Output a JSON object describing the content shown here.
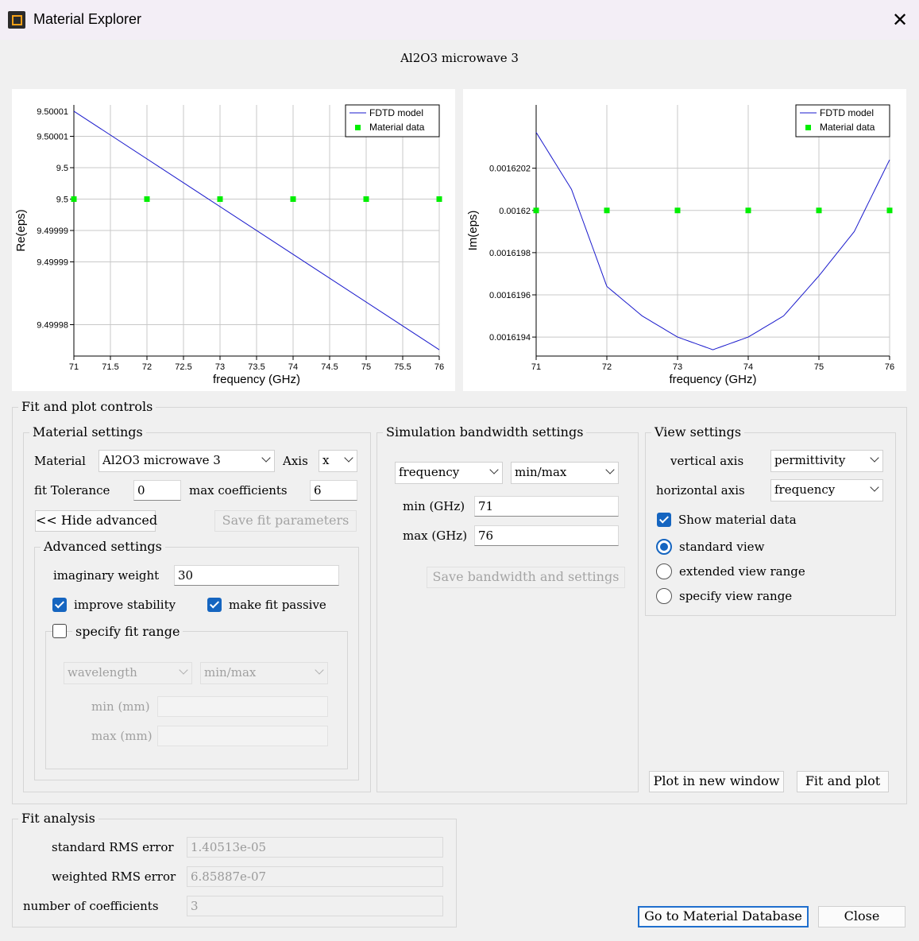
{
  "window": {
    "title": "Material Explorer",
    "close_glyph": "✕"
  },
  "plot_title": "Al2O3 microwave 3",
  "chart_data": [
    {
      "type": "line",
      "ylabel": "Re(eps)",
      "xlabel": "frequency (GHz)",
      "xlim": [
        71,
        76
      ],
      "ylim": [
        9.499975,
        9.500015
      ],
      "xticks": [
        71,
        71.5,
        72,
        72.5,
        73,
        73.5,
        74,
        74.5,
        75,
        75.5,
        76
      ],
      "xtick_labels": [
        "71",
        "71.5",
        "72",
        "72.5",
        "73",
        "73.5",
        "74",
        "74.5",
        "75",
        "75.5",
        "76"
      ],
      "yticks": [
        9.49998,
        9.49999,
        9.499995,
        9.5,
        9.500005,
        9.50001
      ],
      "ytick_labels": [
        "9.49998",
        "9.49999",
        "9.49999",
        "9.5",
        "9.5",
        "9.50001",
        "9.50001"
      ],
      "ytick_values": [
        9.499979,
        9.499989,
        9.499999,
        9.5,
        9.50001,
        9.50002,
        9.50001
      ],
      "legend": [
        "FDTD model",
        "Material data"
      ],
      "legend_position": "top-right",
      "grid": true,
      "series": [
        {
          "name": "FDTD model",
          "style": "line",
          "color": "#1a1acc",
          "x": [
            71,
            76
          ],
          "y": [
            9.500014,
            9.499976
          ]
        },
        {
          "name": "Material data",
          "style": "marker",
          "color": "#00ee00",
          "x": [
            71,
            72,
            73,
            74,
            75,
            76
          ],
          "y": [
            9.5,
            9.5,
            9.5,
            9.5,
            9.5,
            9.5
          ]
        }
      ]
    },
    {
      "type": "line",
      "ylabel": "Im(eps)",
      "xlabel": "frequency (GHz)",
      "xlim": [
        71,
        76
      ],
      "ylim": [
        0.00161931,
        0.0016205
      ],
      "xticks": [
        71,
        72,
        73,
        74,
        75,
        76
      ],
      "xtick_labels": [
        "71",
        "72",
        "73",
        "74",
        "75",
        "76"
      ],
      "yticks": [
        0.0016194,
        0.0016196,
        0.0016198,
        0.00162,
        0.0016202
      ],
      "ytick_labels": [
        "0.0016194",
        "0.0016196",
        "0.0016198",
        "0.00162",
        "0.0016202"
      ],
      "legend": [
        "FDTD model",
        "Material data"
      ],
      "legend_position": "top-right",
      "grid": true,
      "series": [
        {
          "name": "FDTD model",
          "style": "line",
          "color": "#1a1acc",
          "x": [
            71,
            71.5,
            72,
            72.5,
            73,
            73.5,
            74,
            74.5,
            75,
            75.5,
            76
          ],
          "y": [
            0.00162037,
            0.0016201,
            0.00161964,
            0.0016195,
            0.0016194,
            0.00161934,
            0.0016194,
            0.0016195,
            0.00161969,
            0.0016199,
            0.00162024
          ]
        },
        {
          "name": "Material data",
          "style": "marker",
          "color": "#00ee00",
          "x": [
            71,
            72,
            73,
            74,
            75,
            76
          ],
          "y": [
            0.00162,
            0.00162,
            0.00162,
            0.00162,
            0.00162,
            0.00162
          ]
        }
      ]
    }
  ],
  "fit_controls": {
    "title": "Fit and plot controls",
    "material_settings": {
      "title": "Material settings",
      "material_label": "Material",
      "material_value": "Al2O3 microwave 3",
      "axis_label": "Axis",
      "axis_value": "x",
      "tolerance_label": "fit Tolerance",
      "tolerance_value": "0",
      "max_coeff_label": "max coefficients",
      "max_coeff_value": "6",
      "hide_advanced": "<< Hide advanced",
      "save_fit": "Save fit parameters",
      "advanced": {
        "title": "Advanced settings",
        "imag_weight_label": "imaginary weight",
        "imag_weight_value": "30",
        "improve_stability": "improve stability",
        "make_passive": "make fit passive",
        "specify_range": "specify fit range",
        "range_type": "wavelength",
        "range_mode": "min/max",
        "min_label": "min (mm)",
        "max_label": "max (mm)"
      }
    },
    "bandwidth": {
      "title": "Simulation bandwidth settings",
      "type": "frequency",
      "mode": "min/max",
      "min_label": "min (GHz)",
      "min_value": "71",
      "max_label": "max (GHz)",
      "max_value": "76",
      "save_button": "Save bandwidth and settings"
    },
    "view": {
      "title": "View settings",
      "vertical_label": "vertical axis",
      "vertical_value": "permittivity",
      "horizontal_label": "horizontal axis",
      "horizontal_value": "frequency",
      "show_material": "Show material data",
      "radio_standard": "standard view",
      "radio_extended": "extended view range",
      "radio_specify": "specify view range",
      "selected_radio": "standard view"
    },
    "plot_new_window": "Plot in new window",
    "fit_and_plot": "Fit and plot"
  },
  "fit_analysis": {
    "title": "Fit analysis",
    "std_rms_label": "standard RMS error",
    "std_rms_value": "1.40513e-05",
    "weighted_rms_label": "weighted RMS error",
    "weighted_rms_value": "6.85887e-07",
    "num_coeff_label": "number of coefficients",
    "num_coeff_value": "3"
  },
  "buttons": {
    "goto_db": "Go to Material Database",
    "close": "Close"
  },
  "colors": {
    "model": "#1a1acc",
    "data": "#00ee00",
    "accent": "#1565c0"
  }
}
